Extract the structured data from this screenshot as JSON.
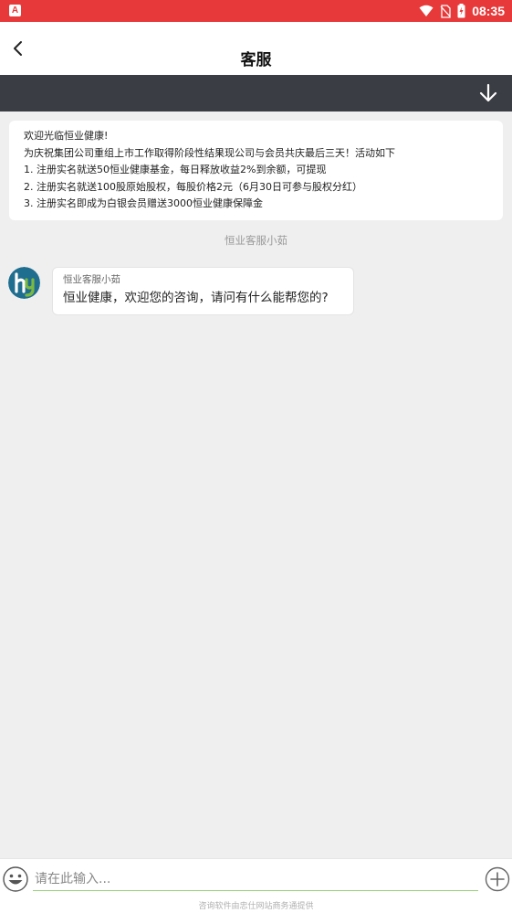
{
  "status_bar": {
    "app_badge": "A",
    "time": "08:35",
    "icons": [
      "wifi-icon",
      "no-sim-icon",
      "battery-charging-icon"
    ]
  },
  "header": {
    "title": "客服",
    "back_icon": "back-chevron-icon"
  },
  "toolbar": {
    "icon": "arrow-down-icon"
  },
  "notice": {
    "lines": [
      "欢迎光临恒业健康!",
      "为庆祝集团公司重组上市工作取得阶段性结果现公司与会员共庆最后三天！活动如下",
      "1.  注册实名就送50恒业健康基金，每日释放收益2%到余额，可提现",
      "2.  注册实名就送100股原始股权，每股价格2元（6月30日可参与股权分红）",
      "3.  注册实名即成为白银会员赠送3000恒业健康保障金"
    ]
  },
  "chat": {
    "agent_label": "恒业客服小茹",
    "messages": [
      {
        "sender": "恒业客服小茹",
        "text": "恒业健康，欢迎您的咨询，请问有什么能帮您的?"
      }
    ]
  },
  "input": {
    "placeholder": "请在此输入...",
    "value": "",
    "footer": "咨询软件由忠仕网站商务通提供"
  },
  "colors": {
    "status_bar": "#e8393a",
    "toolbar": "#3b3d44",
    "background": "#efefef",
    "input_underline": "#9bd07b",
    "avatar_blue": "#1f6d8f",
    "avatar_green": "#7ab842"
  }
}
